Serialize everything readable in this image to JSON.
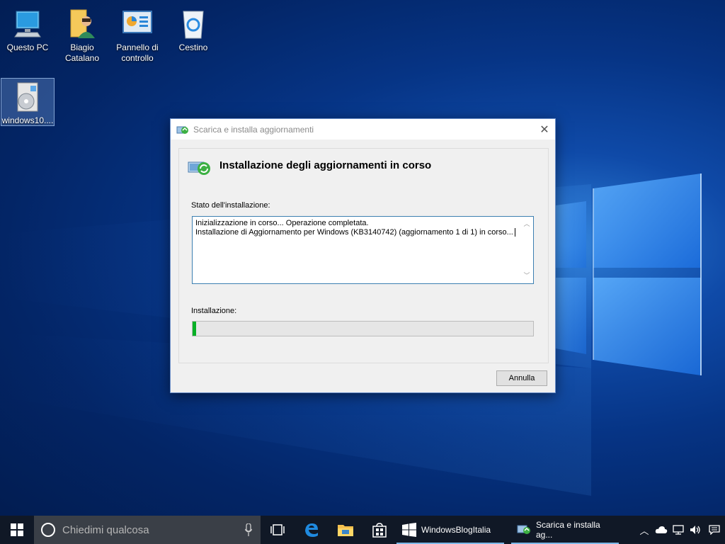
{
  "desktop": {
    "icons": [
      {
        "label": "Questo PC",
        "icon": "this-pc-icon"
      },
      {
        "label": "Biagio Catalano",
        "icon": "user-folder-icon"
      },
      {
        "label": "Pannello di controllo",
        "icon": "control-panel-icon"
      },
      {
        "label": "Cestino",
        "icon": "recycle-bin-icon"
      },
      {
        "label": "windows10....",
        "icon": "installer-package-icon"
      }
    ]
  },
  "dialog": {
    "title": "Scarica e installa aggiornamenti",
    "heading": "Installazione degli aggiornamenti in corso",
    "status_label": "Stato dell'installazione:",
    "log_lines": [
      "Inizializzazione in corso... Operazione completata.",
      "Installazione di Aggiornamento per Windows (KB3140742) (aggiornamento 1 di 1) in corso... "
    ],
    "progress_label": "Installazione:",
    "progress_fraction": 0.01,
    "cancel_label": "Annulla",
    "close_symbol": "✕"
  },
  "taskbar": {
    "search_placeholder": "Chiedimi qualcosa",
    "apps": [
      {
        "label": "WindowsBlogItalia",
        "icon": "windows-window-icon"
      },
      {
        "label": "Scarica e installa ag...",
        "icon": "update-installer-icon"
      }
    ]
  },
  "colors": {
    "accent": "#3c7fb1",
    "progress": "#06b025",
    "taskbar": "#101826"
  }
}
